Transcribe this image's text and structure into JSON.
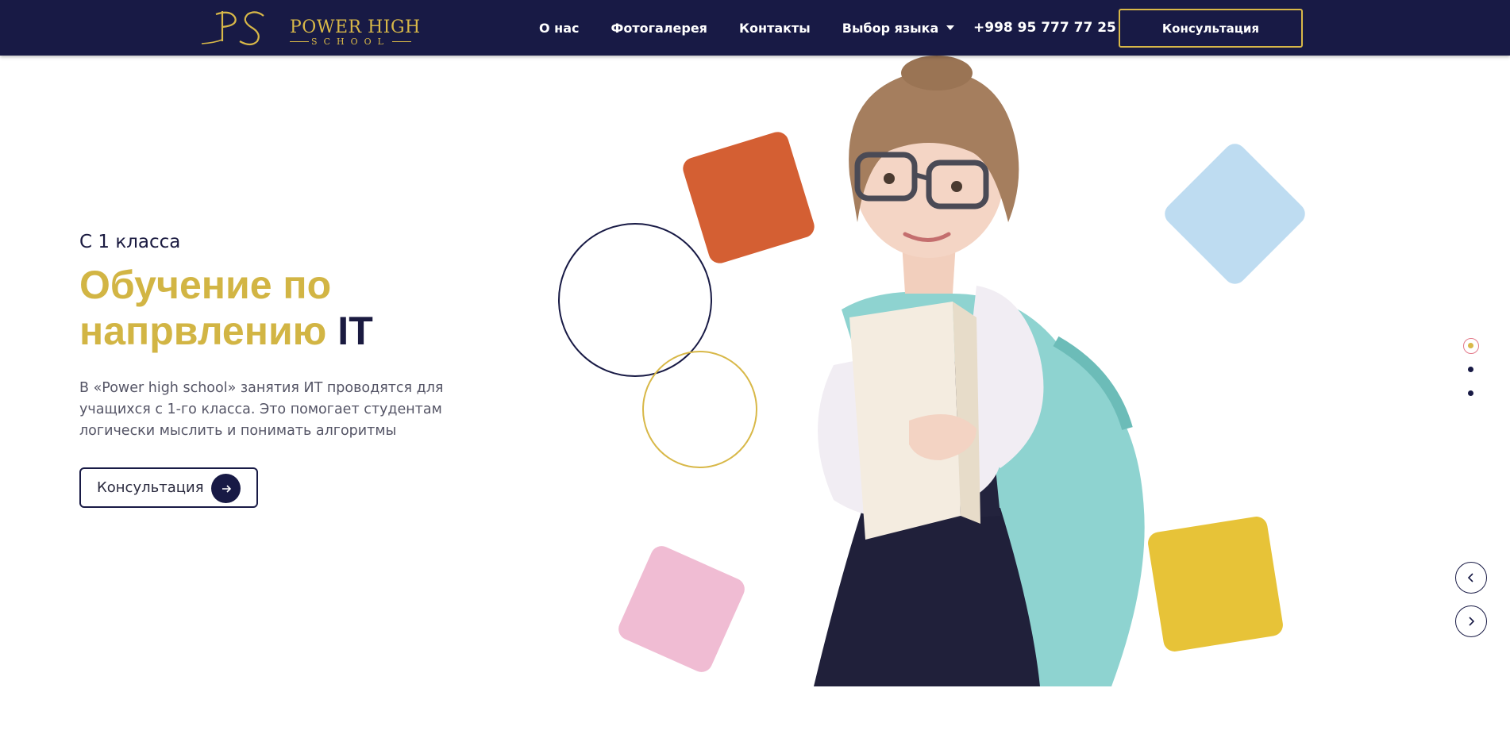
{
  "brand": {
    "mark": "PS",
    "name_line1": "POWER HIGH",
    "name_line2": "SCHOOL"
  },
  "nav": {
    "items": [
      {
        "label": "О нас"
      },
      {
        "label": "Фотогалерея"
      },
      {
        "label": "Контакты"
      },
      {
        "label": "Выбор языка"
      }
    ],
    "phone": "+998 95 777 77 25",
    "consult_label": "Консультация"
  },
  "hero": {
    "subtitle": "С 1 класса",
    "title_main": "Обучение по напрвлению",
    "title_accent": "IT",
    "description": "В «Power high school» занятия ИТ проводятся для учащихся с 1-го класса. Это помогает студентам логически мыслить и понимать алгоритмы",
    "cta_label": "Консультация"
  },
  "slider": {
    "active_slide": 1,
    "slide_count": 3
  },
  "colors": {
    "header_bg": "#181a45",
    "gold": "#d2b544",
    "navy": "#1a1a40",
    "orange": "#d45f33",
    "light_blue": "#bedcf1",
    "pink": "#f0bcd3",
    "yellow": "#e7c338"
  },
  "icons": {
    "cta_arrow": "arrow-right-icon",
    "lang_caret": "caret-down-icon",
    "prev": "chevron-left-icon",
    "next": "chevron-right-icon"
  }
}
